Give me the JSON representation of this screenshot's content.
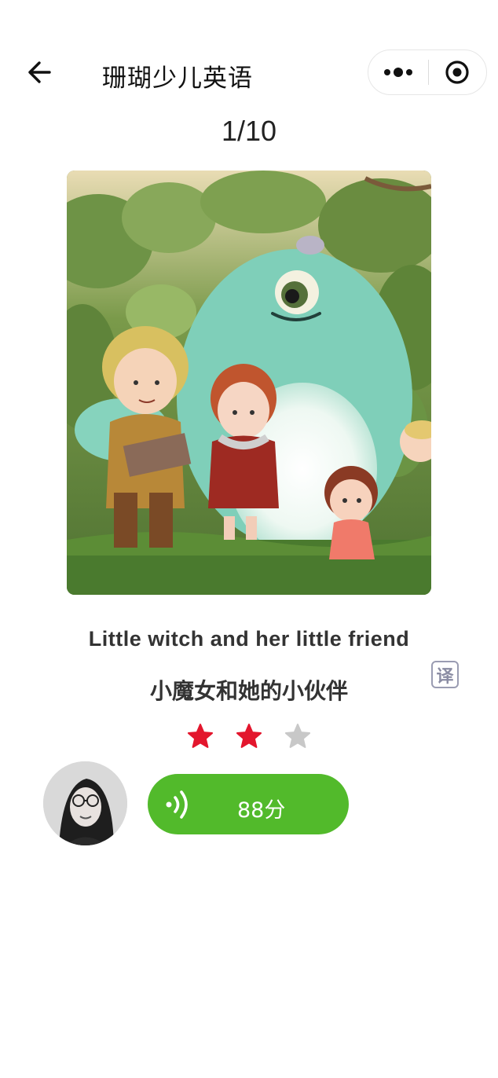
{
  "header": {
    "title": "珊瑚少儿英语",
    "back_icon": "arrow-left-icon",
    "more_icon": "more-dots-icon",
    "close_icon": "target-circle-icon"
  },
  "progress": {
    "label": "1/10",
    "current": 1,
    "total": 10
  },
  "sentence": {
    "english": "Little witch and her little friend",
    "chinese": "小魔女和她的小伙伴",
    "translate_label": "译"
  },
  "rating": {
    "stars_filled": 2,
    "stars_total": 3,
    "filled_color": "#e3162d",
    "empty_color": "#c8c8c8"
  },
  "recording": {
    "score_label": "88分",
    "play_icon": "voice-wave-icon",
    "button_color": "#52ba2b"
  }
}
